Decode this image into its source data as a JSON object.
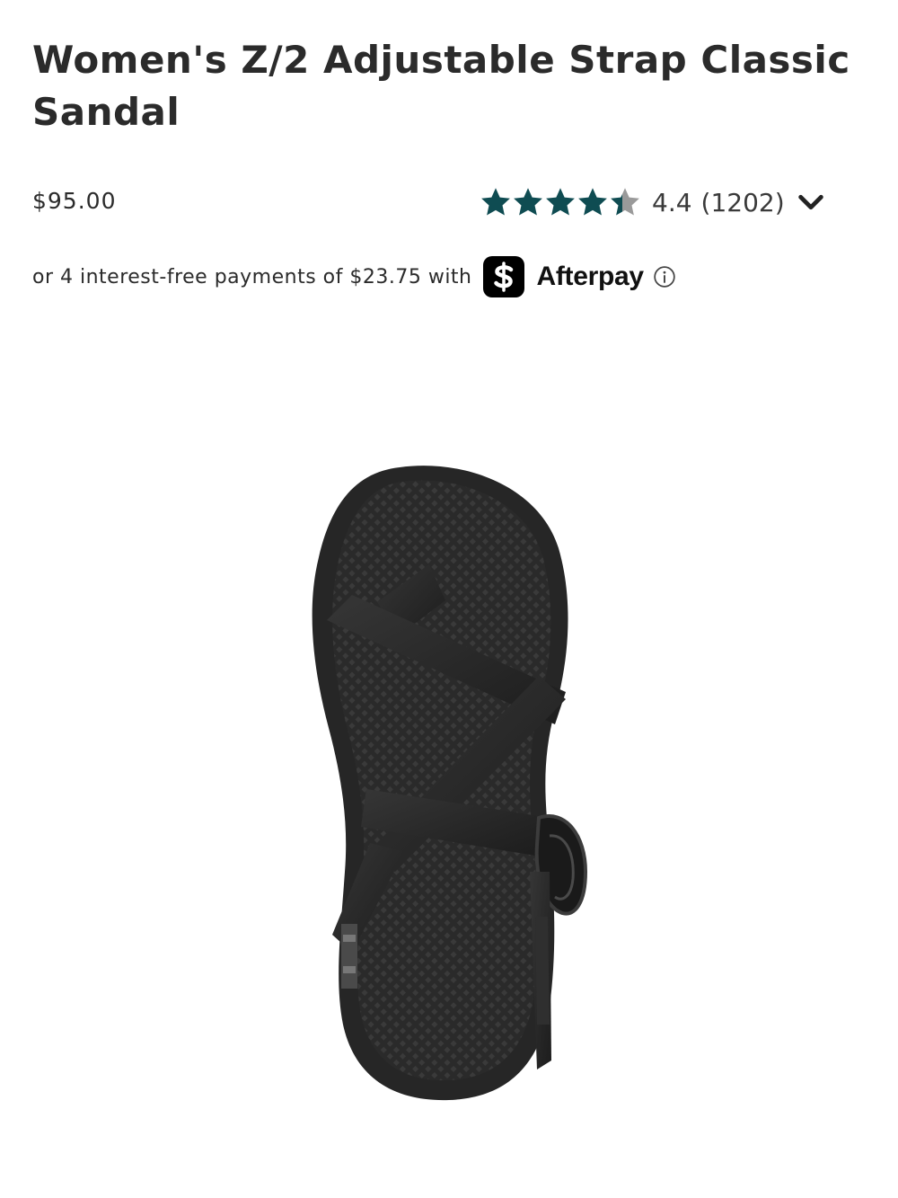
{
  "product": {
    "title": "Women's Z/2 Adjustable Strap Classic Sandal",
    "price": "$95.00"
  },
  "rating": {
    "value": "4.4",
    "count": "(1202)",
    "stars_filled": 4.4,
    "stars_total": 5,
    "star_color": "#0f4c52",
    "star_empty_color": "#9a9a9a",
    "toggle_icon": "chevron-down-icon"
  },
  "payment": {
    "text": "or 4 interest-free payments of $23.75 with",
    "brand_logo_icon": "cash-app-icon",
    "brand": "Afterpay",
    "info_icon": "info-icon"
  },
  "image": {
    "subject": "sandal-image"
  }
}
